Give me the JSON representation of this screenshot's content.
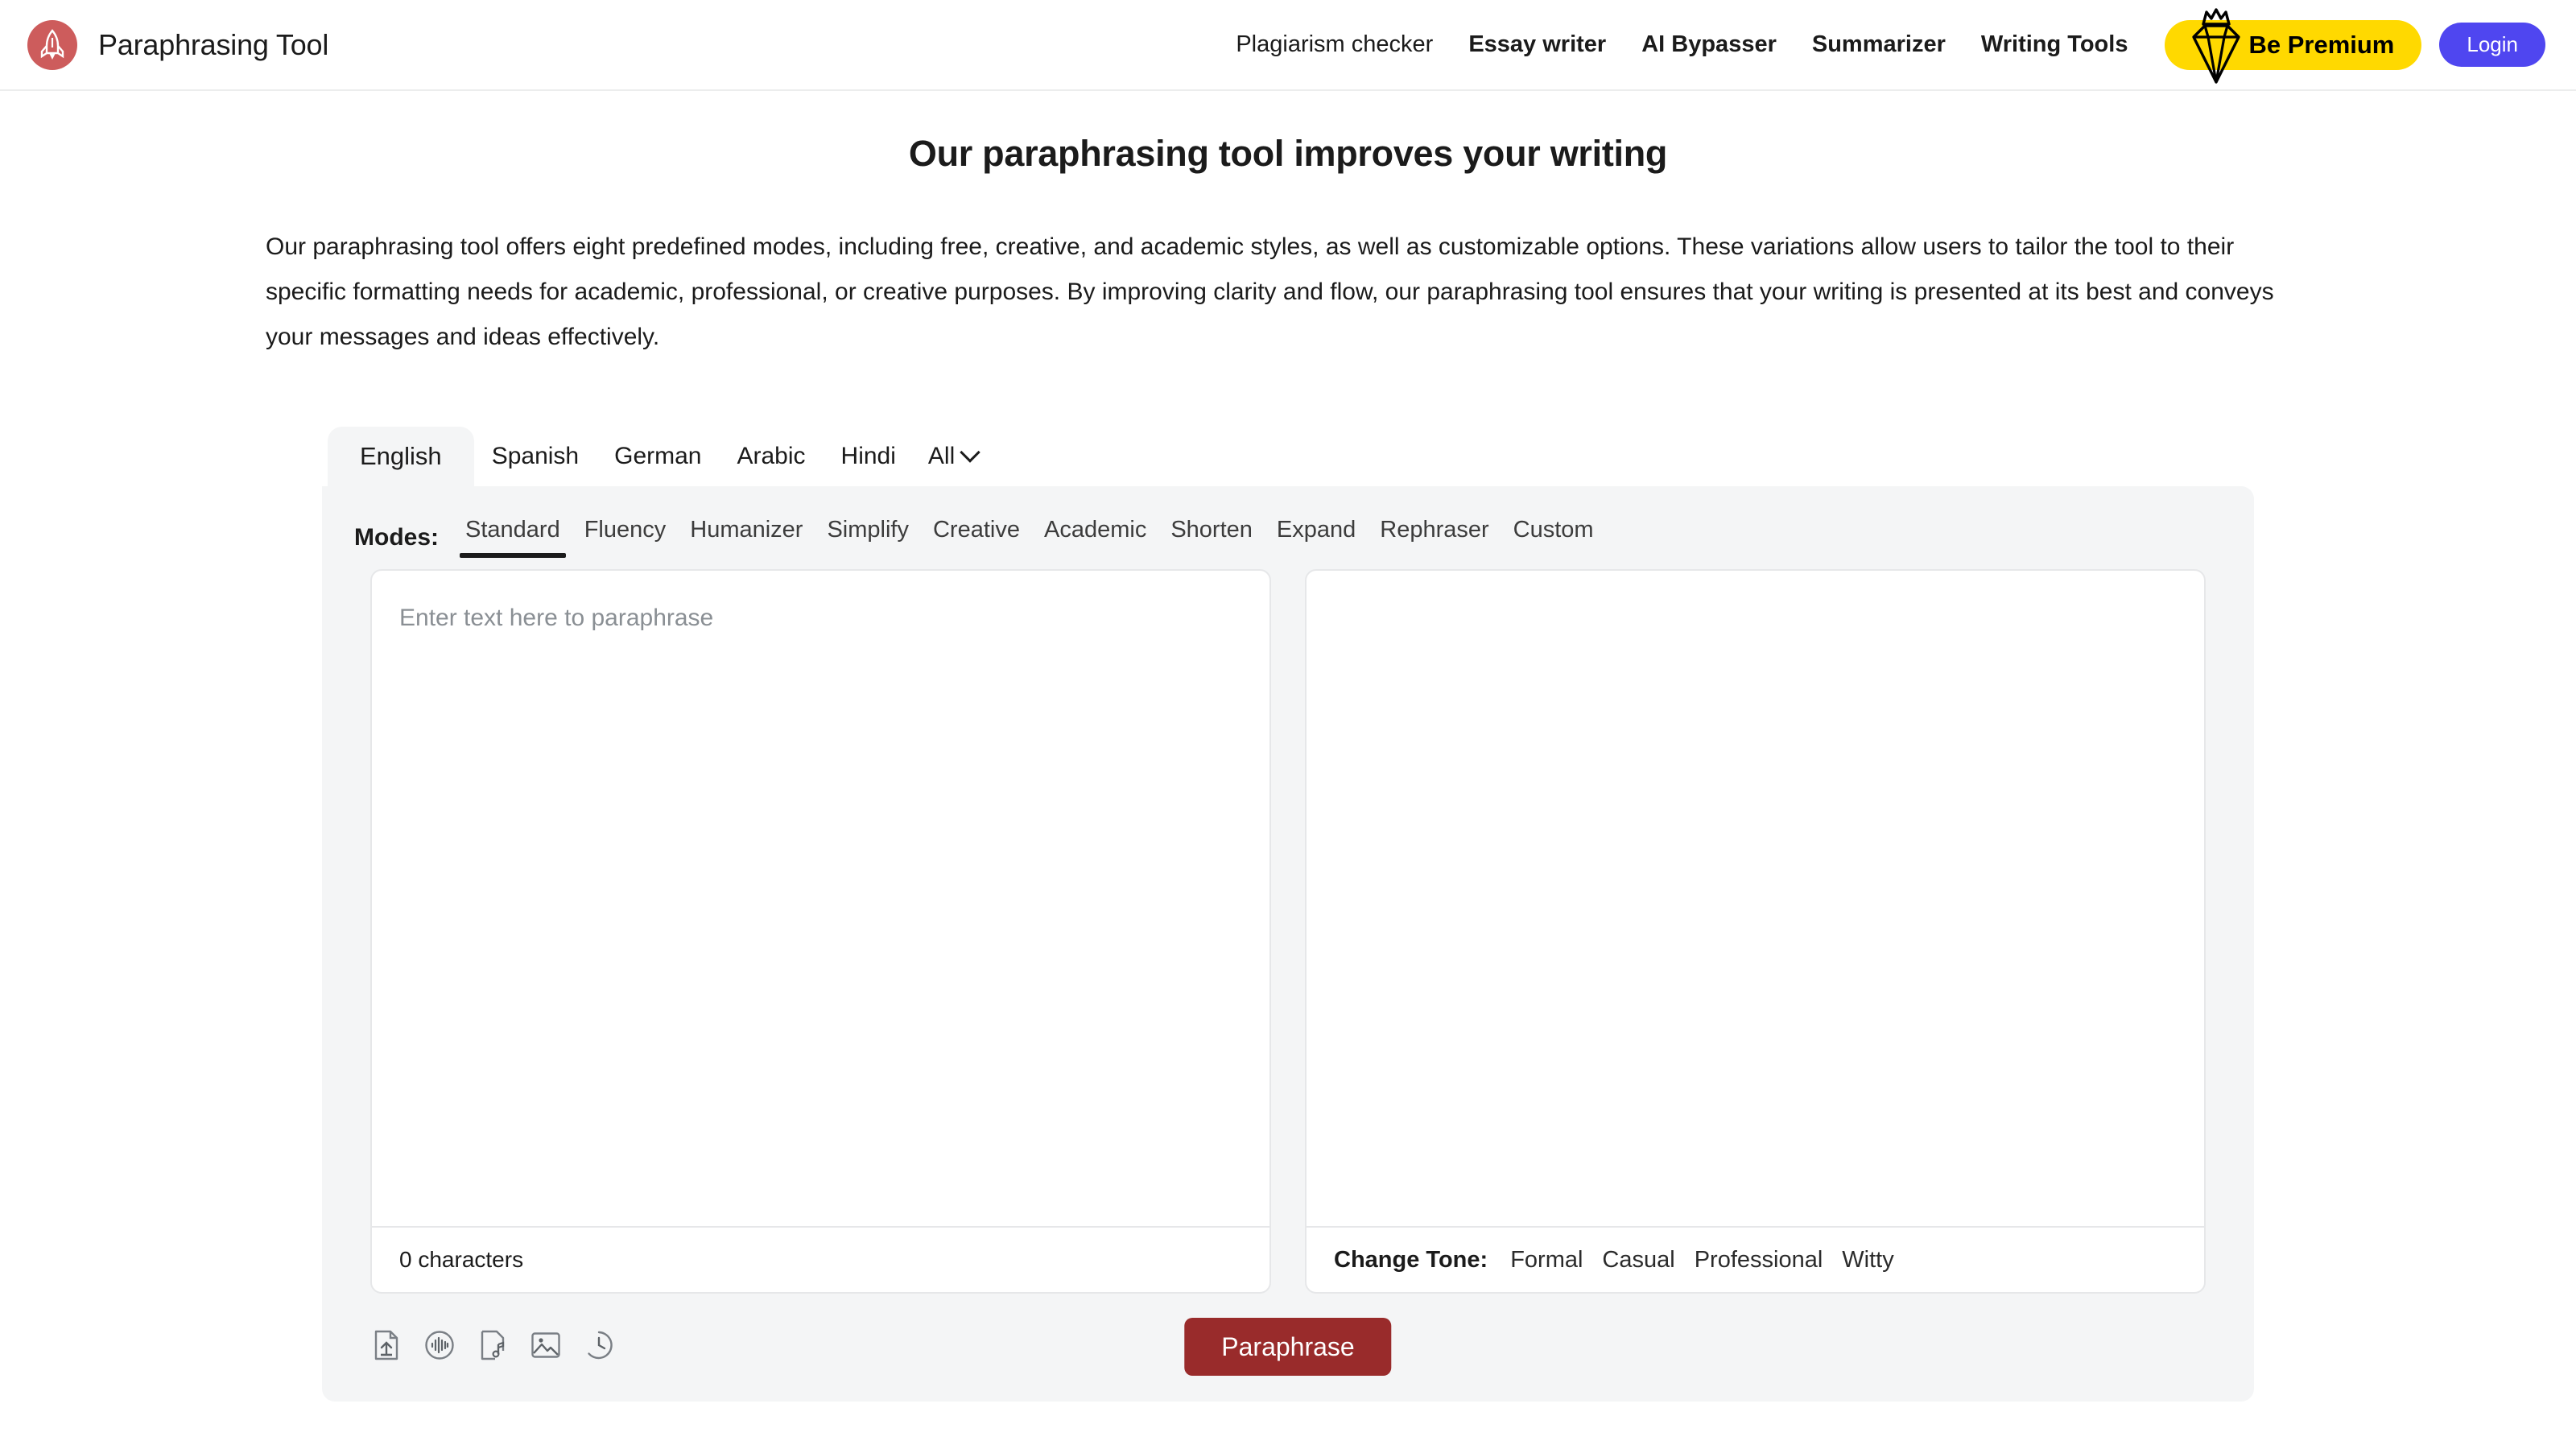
{
  "header": {
    "brand_name": "Paraphrasing Tool",
    "logo_icon": "rocket-icon",
    "nav_links": [
      {
        "label": "Plagiarism checker",
        "bold": false
      },
      {
        "label": "Essay writer",
        "bold": true
      },
      {
        "label": "AI Bypasser",
        "bold": true
      },
      {
        "label": "Summarizer",
        "bold": true
      },
      {
        "label": "Writing Tools",
        "bold": true
      }
    ],
    "premium_label": "Be Premium",
    "premium_icon": "diamond-crown-icon",
    "login_label": "Login",
    "colors": {
      "logo_bg": "#cd5c5c",
      "premium_bg": "#ffd900",
      "login_bg": "#4f46f0"
    }
  },
  "hero": {
    "title": "Our paraphrasing tool improves your writing",
    "paragraph": "Our paraphrasing tool offers eight predefined modes, including free, creative, and academic styles, as well as customizable options. These variations allow users to tailor the tool to their specific formatting needs for academic, professional, or creative purposes. By improving clarity and flow, our paraphrasing tool ensures that your writing is presented at its best and conveys your messages and ideas effectively."
  },
  "tool": {
    "languages": [
      {
        "label": "English",
        "active": true
      },
      {
        "label": "Spanish",
        "active": false
      },
      {
        "label": "German",
        "active": false
      },
      {
        "label": "Arabic",
        "active": false
      },
      {
        "label": "Hindi",
        "active": false
      }
    ],
    "languages_more_label": "All",
    "modes_label": "Modes:",
    "modes": [
      {
        "label": "Standard",
        "active": true
      },
      {
        "label": "Fluency",
        "active": false
      },
      {
        "label": "Humanizer",
        "active": false
      },
      {
        "label": "Simplify",
        "active": false
      },
      {
        "label": "Creative",
        "active": false
      },
      {
        "label": "Academic",
        "active": false
      },
      {
        "label": "Shorten",
        "active": false
      },
      {
        "label": "Expand",
        "active": false
      },
      {
        "label": "Rephraser",
        "active": false
      },
      {
        "label": "Custom",
        "active": false
      }
    ],
    "input": {
      "placeholder": "Enter text here to paraphrase",
      "value": "",
      "char_count": "0 characters"
    },
    "output": {
      "value": "",
      "tone_label": "Change Tone:",
      "tones": [
        "Formal",
        "Casual",
        "Professional",
        "Witty"
      ]
    },
    "toolbar_icons": [
      "upload-document-icon",
      "voice-waveform-icon",
      "audio-file-icon",
      "image-upload-icon",
      "history-clock-icon"
    ],
    "paraphrase_label": "Paraphrase",
    "colors": {
      "panel_bg": "#f4f5f6",
      "paraphrase_bg": "#992b2b"
    }
  }
}
